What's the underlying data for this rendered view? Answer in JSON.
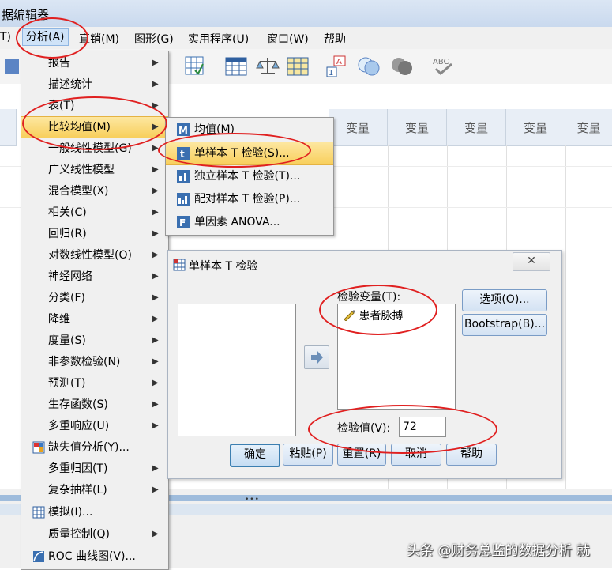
{
  "window": {
    "title_fragment": "据编辑器"
  },
  "menubar": {
    "items": [
      {
        "label": "T)"
      },
      {
        "label": "分析(A)"
      },
      {
        "label": "直销(M)"
      },
      {
        "label": "图形(G)"
      },
      {
        "label": "实用程序(U)"
      },
      {
        "label": "窗口(W)"
      },
      {
        "label": "帮助"
      }
    ]
  },
  "grid": {
    "column_header": "变量"
  },
  "analyze_menu": {
    "items": [
      {
        "label": "报告",
        "submenu": true
      },
      {
        "label": "描述统计",
        "submenu": true
      },
      {
        "label": "表(T)",
        "submenu": true
      },
      {
        "label": "比较均值(M)",
        "submenu": true,
        "highlighted": true
      },
      {
        "label": "一般线性模型(G)",
        "submenu": true
      },
      {
        "label": "广义线性模型",
        "submenu": true
      },
      {
        "label": "混合模型(X)",
        "submenu": true
      },
      {
        "label": "相关(C)",
        "submenu": true
      },
      {
        "label": "回归(R)",
        "submenu": true
      },
      {
        "label": "对数线性模型(O)",
        "submenu": true
      },
      {
        "label": "神经网络",
        "submenu": true
      },
      {
        "label": "分类(F)",
        "submenu": true
      },
      {
        "label": "降维",
        "submenu": true
      },
      {
        "label": "度量(S)",
        "submenu": true
      },
      {
        "label": "非参数检验(N)",
        "submenu": true
      },
      {
        "label": "预测(T)",
        "submenu": true
      },
      {
        "label": "生存函数(S)",
        "submenu": true
      },
      {
        "label": "多重响应(U)",
        "submenu": true
      },
      {
        "label": "缺失值分析(Y)...",
        "submenu": false,
        "icon": "missing-values-icon"
      },
      {
        "label": "多重归因(T)",
        "submenu": true
      },
      {
        "label": "复杂抽样(L)",
        "submenu": true
      },
      {
        "label": "模拟(I)...",
        "submenu": false,
        "icon": "simulation-icon"
      },
      {
        "label": "质量控制(Q)",
        "submenu": true
      },
      {
        "label": "ROC 曲线图(V)...",
        "submenu": false,
        "icon": "roc-curve-icon"
      }
    ]
  },
  "compare_means_menu": {
    "items": [
      {
        "label": "均值(M)",
        "icon": "means-icon"
      },
      {
        "label": "单样本 T 检验(S)...",
        "icon": "one-sample-t-icon",
        "highlighted": true
      },
      {
        "label": "独立样本 T 检验(T)...",
        "icon": "independent-t-icon"
      },
      {
        "label": "配对样本 T 检验(P)...",
        "icon": "paired-t-icon"
      },
      {
        "label": "单因素 ANOVA...",
        "icon": "anova-icon"
      }
    ]
  },
  "dialog": {
    "title": "单样本 T 检验",
    "close": "✕",
    "test_variables_label": "检验变量(T):",
    "test_variable_item": "患者脉搏",
    "test_value_label": "检验值(V):",
    "test_value": "72",
    "options_button": "选项(O)...",
    "bootstrap_button": "Bootstrap(B)...",
    "ok_button": "确定",
    "paste_button": "粘贴(P)",
    "reset_button": "重置(R)",
    "cancel_button": "取消",
    "help_button": "帮助"
  },
  "watermark": "头条 @财务总监的数据分析 就",
  "colors": {
    "highlight": "#f8cf5c",
    "annotation": "#e02020",
    "header_bg": "#e8eef6"
  }
}
